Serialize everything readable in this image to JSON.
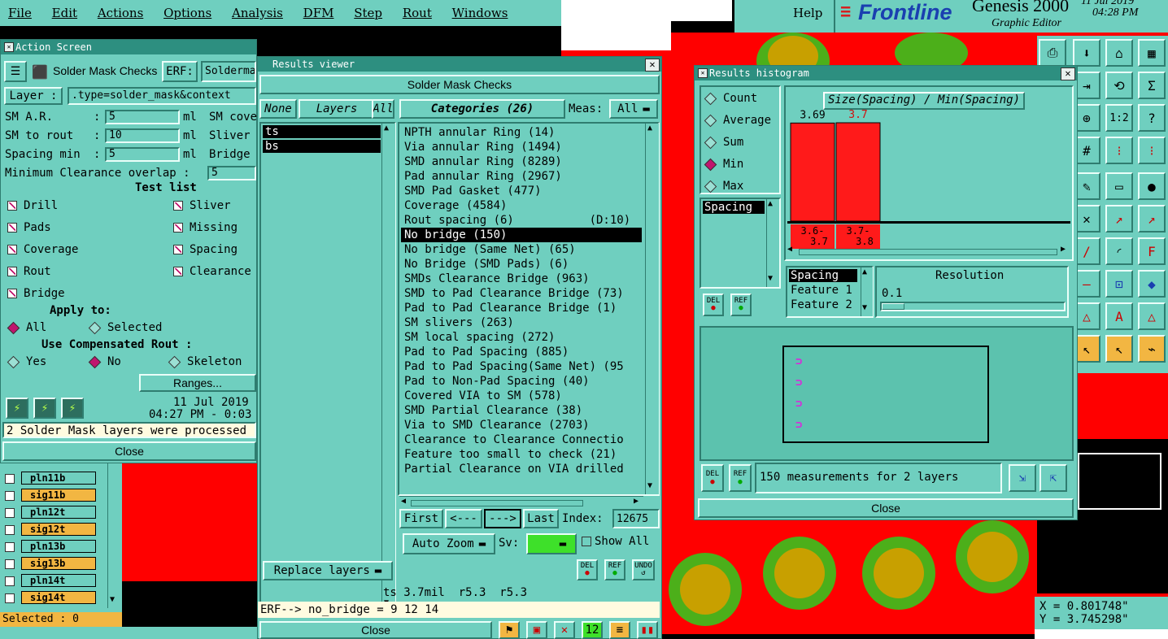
{
  "menubar": {
    "items": [
      "File",
      "Edit",
      "Actions",
      "Options",
      "Analysis",
      "DFM",
      "Step",
      "Rout",
      "Windows"
    ],
    "help": "Help",
    "brand": "Frontline",
    "product": "Genesis 2000",
    "subtitle": "Graphic Editor",
    "date": "11 Jul 2019",
    "time": "04:28 PM"
  },
  "action_screen": {
    "title": "Action Screen",
    "header_label": "Solder Mask Checks",
    "erf_label": "ERF:",
    "erf_value": "Soldermask",
    "layer_label": "Layer :",
    "layer_value": ".type=solder_mask&context",
    "params": [
      {
        "label": "SM A.R.",
        "value": "5",
        "unit": "ml",
        "extra": "SM cove"
      },
      {
        "label": "SM to rout",
        "value": "10",
        "unit": "ml",
        "extra": "Sliver"
      },
      {
        "label": "Spacing min",
        "value": "5",
        "unit": "ml",
        "extra": "Bridge"
      }
    ],
    "min_clearance_label": "Minimum Clearance overlap :",
    "min_clearance_value": "5",
    "test_list_label": "Test list",
    "tests_left": [
      "Drill",
      "Pads",
      "Coverage",
      "Rout",
      "Bridge"
    ],
    "tests_right": [
      "Sliver",
      "Missing",
      "Spacing",
      "Clearance"
    ],
    "apply_to_label": "Apply to:",
    "apply_all": "All",
    "apply_selected": "Selected",
    "compensated_label": "Use Compensated Rout :",
    "comp_yes": "Yes",
    "comp_no": "No",
    "comp_skeleton": "Skeleton",
    "ranges_button": "Ranges...",
    "footer_date": "11 Jul 2019",
    "footer_time": "04:27 PM - 0:03",
    "status": "2 Solder Mask layers were processed",
    "close": "Close"
  },
  "layer_list": {
    "items": [
      {
        "name": "pln11b",
        "color": "#6fcfbf"
      },
      {
        "name": "sig11b",
        "color": "#f2b642"
      },
      {
        "name": "pln12t",
        "color": "#6fcfbf"
      },
      {
        "name": "sig12t",
        "color": "#f2b642"
      },
      {
        "name": "pln13b",
        "color": "#6fcfbf"
      },
      {
        "name": "sig13b",
        "color": "#f2b642"
      },
      {
        "name": "pln14t",
        "color": "#6fcfbf"
      },
      {
        "name": "sig14t",
        "color": "#f2b642"
      }
    ],
    "selected": "Selected : 0"
  },
  "results_viewer": {
    "title": "Results viewer",
    "header": "Solder Mask Checks",
    "none_btn": "None",
    "layers_btn": "Layers",
    "all_btn": "All",
    "categories_label": "Categories (26)",
    "meas_label": "Meas:",
    "meas_value": "All",
    "layers": [
      "ts",
      "bs"
    ],
    "categories": [
      "NPTH annular Ring (14)",
      "Via annular Ring (1494)",
      "SMD annular Ring (8289)",
      "Pad annular Ring (2967)",
      "SMD Pad Gasket (477)",
      "Coverage (4584)",
      "Rout spacing (6)           (D:10)",
      "No bridge (150)",
      "No bridge (Same Net) (65)",
      "No Bridge (SMD Pads) (6)",
      "SMDs Clearance Bridge (963)",
      "SMD to Pad Clearance Bridge (73)",
      "Pad to Pad Clearance Bridge (1)",
      "SM slivers (263)",
      "SM local spacing (272)",
      "Pad to Pad Spacing (885)",
      "Pad to Pad Spacing(Same Net) (95",
      "Pad to Non-Pad Spacing (40)",
      "Covered VIA to SM (578)",
      "SMD Partial Clearance (38)",
      "Via to SMD Clearance (2703)",
      "Clearance to Clearance Connectio",
      "Feature too small to check (21)",
      "Partial Clearance on VIA drilled"
    ],
    "selected_category_index": 7,
    "first": "First",
    "prev": "<---",
    "next": "--->",
    "last": "Last",
    "index_label": "Index:",
    "index_value": "12675",
    "auto_zoom": "Auto Zoom",
    "sv_label": "Sv:",
    "show_all": "Show All",
    "replace_layers": "Replace layers",
    "del": "DEL",
    "ref": "REF",
    "undo": "UNDO",
    "info_line": "ts 3.7mil  r5.3  r5.3",
    "erf_line": "ERF--> no_bridge = 9 12 14",
    "close": "Close"
  },
  "histogram": {
    "title": "Results histogram",
    "modes": [
      "Count",
      "Average",
      "Sum",
      "Min",
      "Max"
    ],
    "selected_mode": "Min",
    "chart_title": "Size(Spacing) / Min(Spacing)",
    "measure_list": [
      "Spacing"
    ],
    "feature_list": [
      "Spacing",
      "Feature 1",
      "Feature 2"
    ],
    "resolution_label": "Resolution",
    "resolution_value": "0.1",
    "del": "DEL",
    "ref": "REF",
    "measurement_count": "150 measurements for 2 layers",
    "close": "Close",
    "bar_color": "#ff1a1a",
    "chart_data": {
      "type": "bar",
      "categories": [
        "3.6-3.7",
        "3.7-3.8"
      ],
      "values": [
        3.69,
        3.7
      ],
      "value_labels": [
        "3.69",
        "3.7"
      ],
      "title": "Size(Spacing) / Min(Spacing)"
    }
  },
  "coords": {
    "x": "X = 0.801748\"",
    "y": "Y = 3.745298\""
  },
  "colors": {
    "panel": "#6fcfbf",
    "board_red": "#ff0000",
    "pad_green": "#4caf1a",
    "pad_gold": "#c8a000"
  }
}
